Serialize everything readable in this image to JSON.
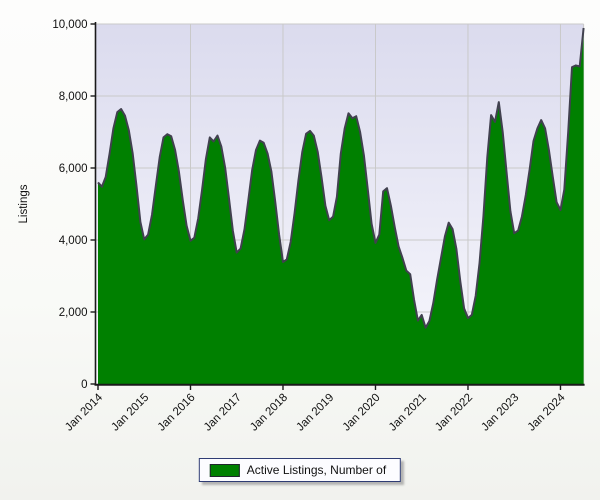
{
  "legend": {
    "label": "Active Listings, Number of",
    "position": "bottom-center"
  },
  "colors": {
    "series_green": "#008000",
    "series_outline": "#41414f",
    "grid": "#c9c9c9",
    "axis": "#1a1a1a",
    "plot_bg_top": "#dbdbee",
    "plot_bg_bottom": "#f8f8fd",
    "legend_border": "#2f3c73",
    "legend_bg": "#fcfcff",
    "tick_text": "#111111"
  },
  "chart_data": {
    "type": "area",
    "title": "",
    "xlabel": "",
    "ylabel": "Listings",
    "ylim": [
      0,
      10000
    ],
    "y_ticks": [
      {
        "value": 0,
        "label": "0"
      },
      {
        "value": 2000,
        "label": "2,000"
      },
      {
        "value": 4000,
        "label": "4,000"
      },
      {
        "value": 6000,
        "label": "6,000"
      },
      {
        "value": 8000,
        "label": "8,000"
      },
      {
        "value": 10000,
        "label": "10,000"
      }
    ],
    "x_ticks": [
      {
        "month": 0,
        "label": "Jan 2014"
      },
      {
        "month": 12,
        "label": "Jan 2015"
      },
      {
        "month": 24,
        "label": "Jan 2016"
      },
      {
        "month": 36,
        "label": "Jan 2017"
      },
      {
        "month": 48,
        "label": "Jan 2018"
      },
      {
        "month": 60,
        "label": "Jan 2019"
      },
      {
        "month": 72,
        "label": "Jan 2020"
      },
      {
        "month": 84,
        "label": "Jan 2021"
      },
      {
        "month": 96,
        "label": "Jan 2022"
      },
      {
        "month": 108,
        "label": "Jan 2023"
      },
      {
        "month": 120,
        "label": "Jan 2024"
      }
    ],
    "grid": {
      "horizontal": true,
      "vertical_gridline_months": [
        24,
        48,
        72,
        96,
        120
      ],
      "x_tickmark_months": [
        0,
        24,
        48,
        72,
        96,
        120
      ]
    },
    "legend_position": "bottom",
    "series": [
      {
        "name": "Active Listings, Number of",
        "interval": "monthly",
        "start": "Jan 2014",
        "end": "Jul 2024",
        "values": [
          5600,
          5480,
          5750,
          6400,
          7100,
          7550,
          7640,
          7450,
          7050,
          6400,
          5500,
          4500,
          4020,
          4150,
          4700,
          5500,
          6300,
          6850,
          6940,
          6880,
          6500,
          5900,
          5100,
          4400,
          3980,
          4060,
          4600,
          5400,
          6250,
          6850,
          6740,
          6900,
          6600,
          6000,
          5150,
          4250,
          3650,
          3760,
          4300,
          5100,
          5950,
          6500,
          6760,
          6700,
          6400,
          5900,
          5050,
          4150,
          3390,
          3460,
          3950,
          4750,
          5650,
          6450,
          6950,
          7030,
          6900,
          6450,
          5750,
          4950,
          4550,
          4650,
          5200,
          6400,
          7100,
          7520,
          7380,
          7440,
          7000,
          6350,
          5400,
          4450,
          3920,
          4150,
          5350,
          5440,
          4950,
          4350,
          3820,
          3500,
          3150,
          3050,
          2350,
          1760,
          1920,
          1565,
          1750,
          2250,
          2900,
          3500,
          4100,
          4480,
          4300,
          3750,
          2850,
          2100,
          1830,
          1920,
          2450,
          3350,
          4650,
          6300,
          7470,
          7280,
          7830,
          7000,
          5900,
          4800,
          4190,
          4260,
          4650,
          5250,
          5950,
          6750,
          7100,
          7330,
          7100,
          6500,
          5750,
          5050,
          4830,
          5400,
          7000,
          8800,
          8850,
          8820,
          9890
        ]
      }
    ]
  }
}
